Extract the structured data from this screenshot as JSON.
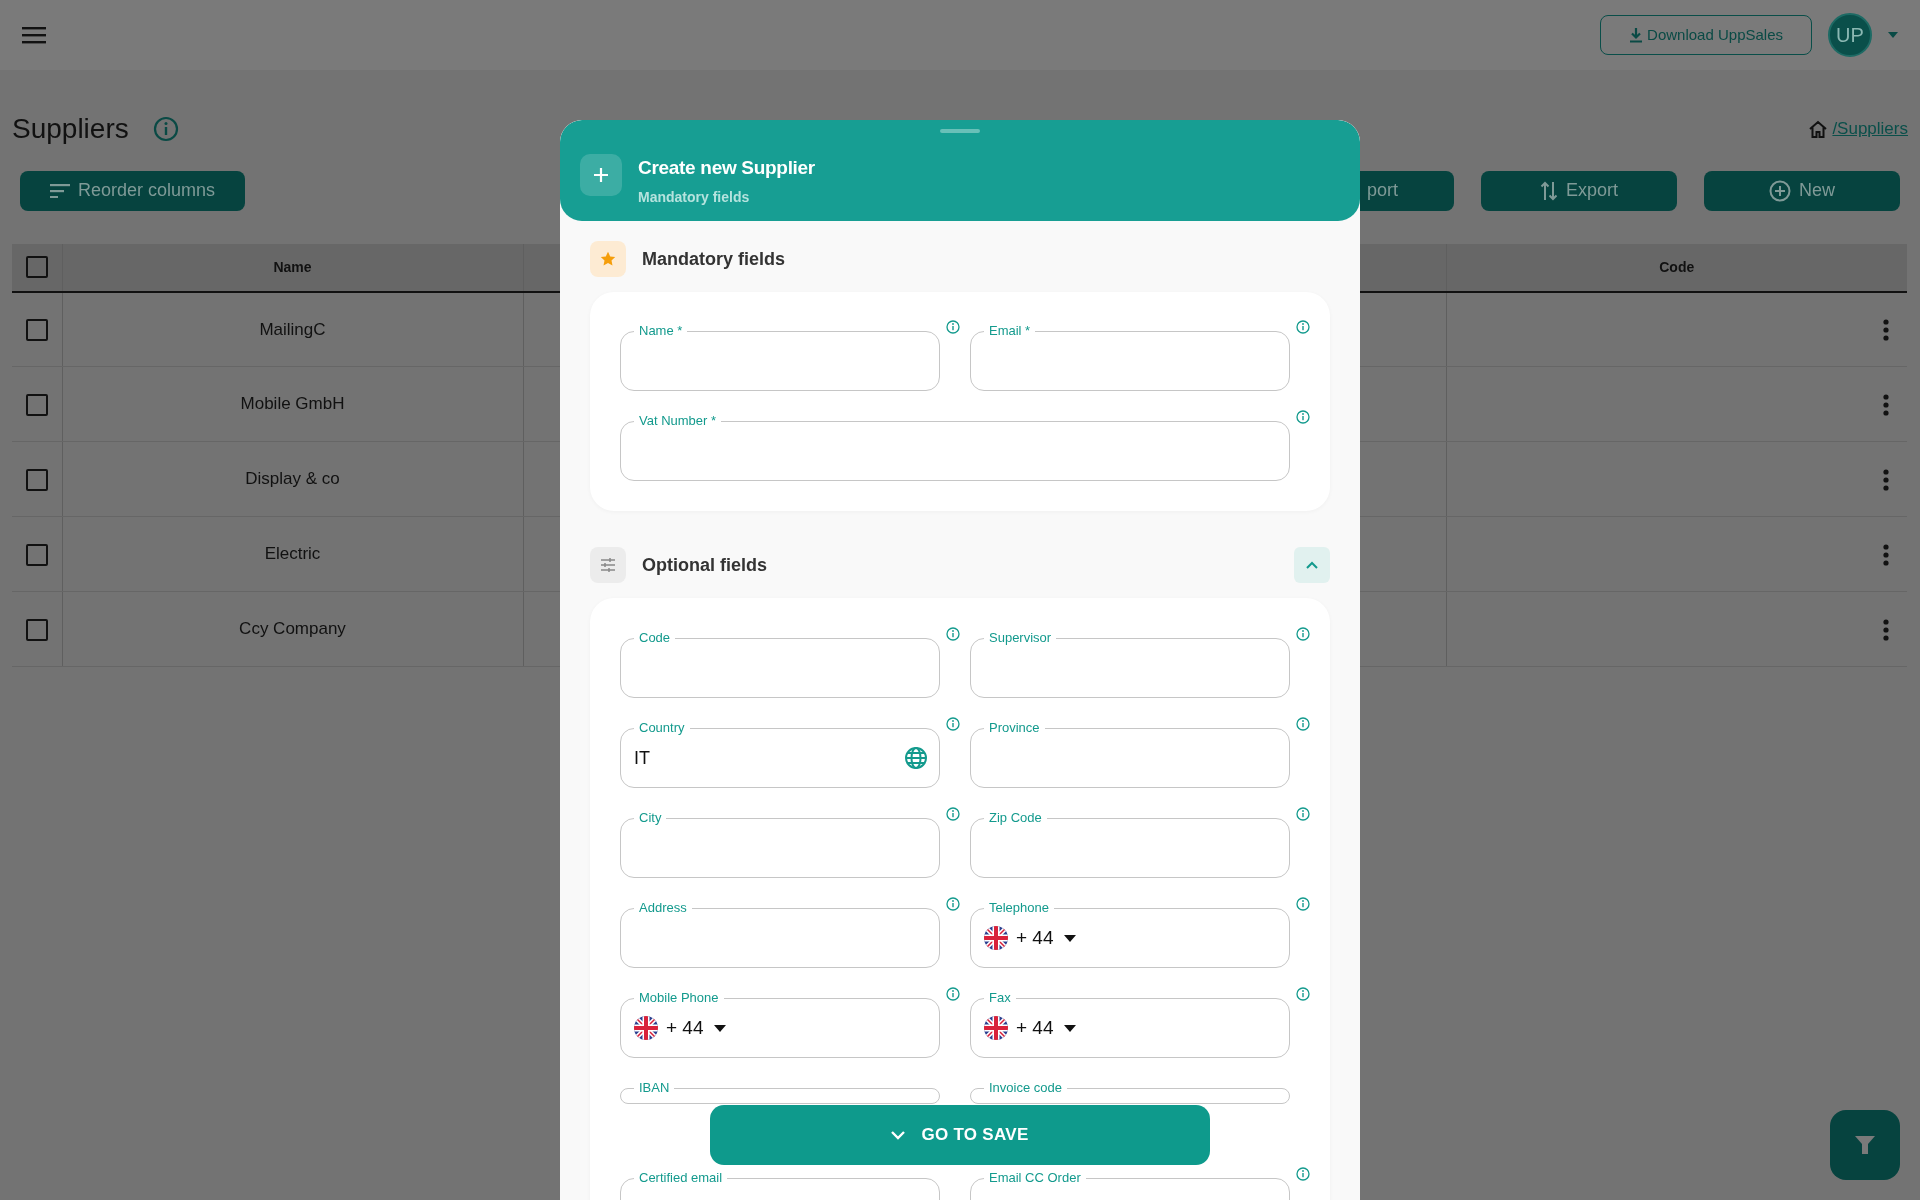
{
  "topbar": {
    "download_button": "Download UppSales",
    "avatar": "UP"
  },
  "page": {
    "title": "Suppliers",
    "breadcrumb": "/Suppliers"
  },
  "toolbar": {
    "reorder_button": "Reorder columns",
    "actions": [
      {
        "kind": "import",
        "label": "port"
      },
      {
        "kind": "export",
        "label": "Export"
      },
      {
        "kind": "new",
        "label": "New"
      }
    ]
  },
  "table": {
    "select_all_checked": false,
    "columns": [
      "Name",
      "Code"
    ],
    "rows": [
      {
        "name": "MailingC",
        "checked": false
      },
      {
        "name": "Mobile GmbH",
        "checked": false
      },
      {
        "name": "Display & co",
        "checked": false
      },
      {
        "name": "Electric",
        "checked": false
      },
      {
        "name": "Ccy Company",
        "checked": false
      }
    ]
  },
  "modal": {
    "title": "Create new Supplier",
    "subtitle": "Mandatory fields",
    "sections": [
      {
        "kind": "mandatory",
        "title": "Mandatory fields",
        "fields": [
          {
            "label": "Name *",
            "kind": "text",
            "info": true
          },
          {
            "label": "Email *",
            "kind": "text",
            "info": true
          },
          {
            "label": "Vat Number *",
            "kind": "text",
            "info": true,
            "full_width": true
          }
        ]
      },
      {
        "kind": "optional",
        "title": "Optional fields",
        "expanded": true,
        "fields": [
          {
            "label": "Code",
            "kind": "text",
            "info": true
          },
          {
            "label": "Supervisor",
            "kind": "text",
            "info": true
          },
          {
            "label": "Country",
            "kind": "country",
            "value": "IT",
            "info": true
          },
          {
            "label": "Province",
            "kind": "text",
            "info": true
          },
          {
            "label": "City",
            "kind": "text",
            "info": true
          },
          {
            "label": "Zip Code",
            "kind": "text",
            "info": true
          },
          {
            "label": "Address",
            "kind": "text",
            "info": true
          },
          {
            "label": "Telephone",
            "kind": "phone",
            "prefix": "+ 44",
            "info": true
          },
          {
            "label": "Mobile Phone",
            "kind": "phone",
            "prefix": "+ 44",
            "info": true
          },
          {
            "label": "Fax",
            "kind": "phone",
            "prefix": "+ 44",
            "info": true
          },
          {
            "label": "IBAN",
            "kind": "text",
            "info": false
          },
          {
            "label": "Invoice code",
            "kind": "text",
            "info": false
          },
          {
            "label": "Certified email",
            "kind": "text",
            "info": false
          },
          {
            "label": "Email CC Order",
            "kind": "text",
            "info": true
          }
        ]
      }
    ],
    "save_button": "GO TO SAVE"
  }
}
